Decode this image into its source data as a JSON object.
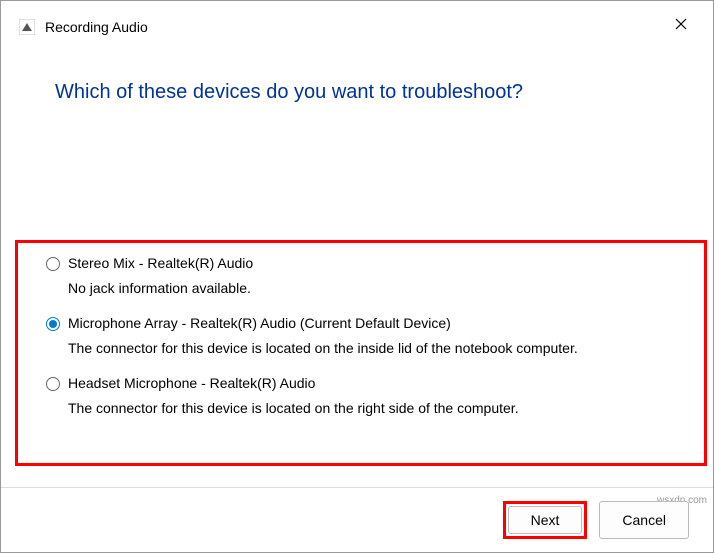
{
  "window": {
    "title": "Recording Audio"
  },
  "heading": "Which of these devices do you want to troubleshoot?",
  "options": [
    {
      "label": "Stereo Mix - Realtek(R) Audio",
      "description": "No jack information available.",
      "selected": false
    },
    {
      "label": "Microphone Array - Realtek(R) Audio (Current Default Device)",
      "description": "The connector for this device is located on the inside lid of the notebook computer.",
      "selected": true
    },
    {
      "label": "Headset Microphone - Realtek(R) Audio",
      "description": "The connector for this device is located on the right side of the computer.",
      "selected": false
    }
  ],
  "buttons": {
    "next": "Next",
    "cancel": "Cancel"
  },
  "watermark": "wsxdn.com"
}
